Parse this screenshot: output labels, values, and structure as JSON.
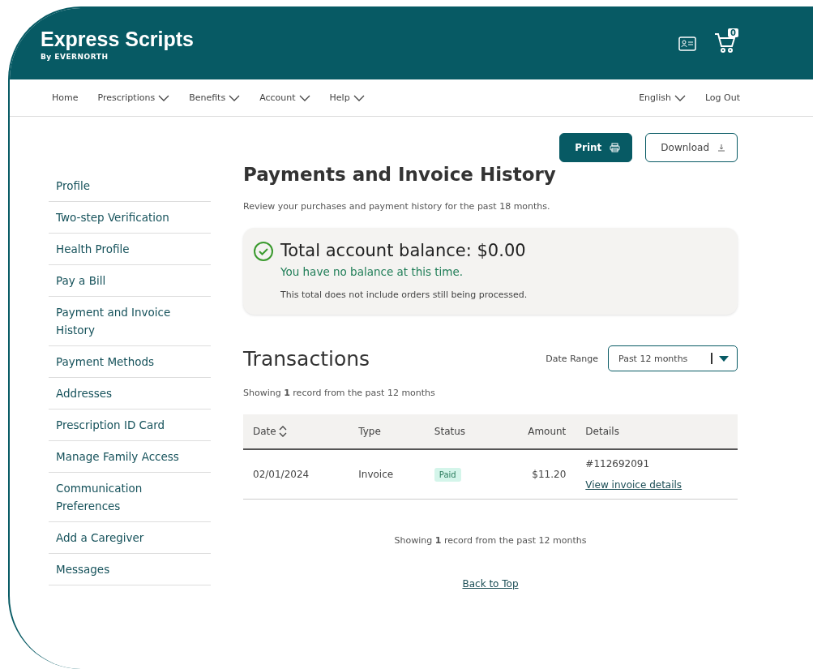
{
  "header": {
    "logo": "Express Scripts",
    "logo_sub": "By EVERNORTH",
    "cart_count": "0"
  },
  "nav": {
    "items": [
      "Home",
      "Prescriptions",
      "Benefits",
      "Account",
      "Help"
    ],
    "language": "English",
    "logout": "Log Out"
  },
  "sidebar": {
    "items": [
      "Profile",
      "Two-step Verification",
      "Health Profile",
      "Pay a Bill",
      "Payment and Invoice History",
      "Payment Methods",
      "Addresses",
      "Prescription ID Card",
      "Manage Family Access",
      "Communication Preferences",
      "Add a Caregiver",
      "Messages"
    ]
  },
  "actions": {
    "print": "Print",
    "download": "Download"
  },
  "page": {
    "title": "Payments and Invoice History",
    "subtitle": "Review your purchases and payment history for the past 18 months."
  },
  "balance": {
    "title": "Total account balance: $0.00",
    "status": "You have no balance at this time.",
    "note": "This total does not include orders still being processed."
  },
  "transactions": {
    "title": "Transactions",
    "date_range_label": "Date Range",
    "date_range_value": "Past 12 months",
    "summary_top": "Showing **1** record from the past 12 months",
    "columns": [
      "Date",
      "Type",
      "Status",
      "Amount",
      "Details"
    ],
    "rows": [
      {
        "date": "02/01/2024",
        "type": "Invoice",
        "status": "Paid",
        "amount": "$11.20",
        "number": "#112692091",
        "link": "View invoice details"
      }
    ],
    "summary_bottom": "Showing **1** record from the past 12 months"
  },
  "back_to_top": "Back to Top"
}
